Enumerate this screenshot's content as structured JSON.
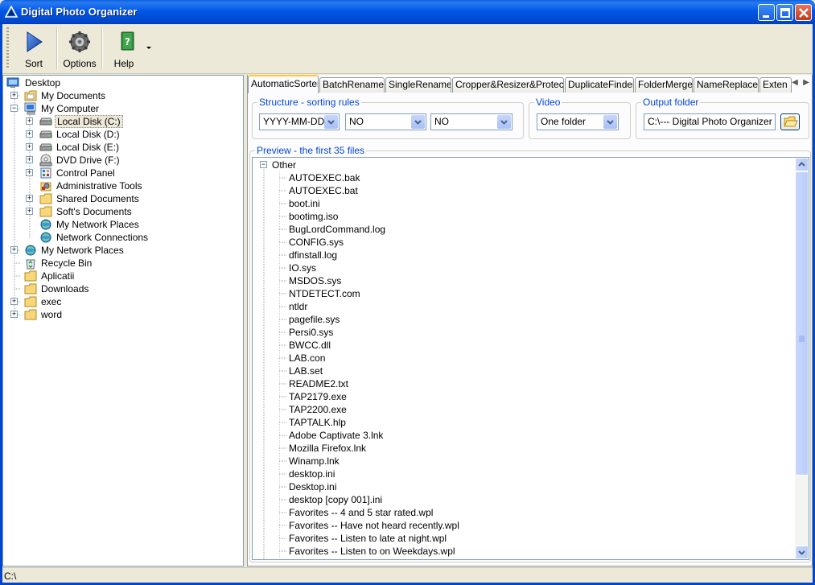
{
  "window": {
    "title": "Digital Photo Organizer"
  },
  "toolbar": {
    "buttons": [
      {
        "label": "Sort",
        "icon": "play-icon"
      },
      {
        "label": "Options",
        "icon": "gear-icon"
      },
      {
        "label": "Help",
        "icon": "help-book-icon"
      }
    ]
  },
  "tree": {
    "nodes": [
      {
        "label": "Desktop",
        "icon": "desktop-icon"
      },
      {
        "label": "My Documents",
        "icon": "folder-icon"
      },
      {
        "label": "My Computer",
        "icon": "computer-icon"
      },
      {
        "label": "Local Disk (C:)",
        "icon": "disk-icon",
        "selected": true
      },
      {
        "label": "Local Disk (D:)",
        "icon": "disk-icon"
      },
      {
        "label": "Local Disk (E:)",
        "icon": "disk-icon"
      },
      {
        "label": "DVD Drive (F:)",
        "icon": "dvd-icon"
      },
      {
        "label": "Control Panel",
        "icon": "control-panel-icon"
      },
      {
        "label": "Administrative Tools",
        "icon": "tools-icon"
      },
      {
        "label": "Shared Documents",
        "icon": "folder-icon"
      },
      {
        "label": "Soft's Documents",
        "icon": "folder-icon"
      },
      {
        "label": "My Network Places",
        "icon": "network-icon"
      },
      {
        "label": "Network Connections",
        "icon": "network-icon"
      },
      {
        "label": "My Network Places",
        "icon": "network-icon"
      },
      {
        "label": "Recycle Bin",
        "icon": "recycle-bin-icon"
      },
      {
        "label": "Aplicatii",
        "icon": "folder-icon"
      },
      {
        "label": "Downloads",
        "icon": "folder-icon"
      },
      {
        "label": "exec",
        "icon": "folder-icon"
      },
      {
        "label": "word",
        "icon": "folder-icon"
      }
    ]
  },
  "tabs": [
    {
      "label": "AutomaticSorter",
      "active": true
    },
    {
      "label": "BatchRenamer"
    },
    {
      "label": "SingleRenamer"
    },
    {
      "label": "Cropper&Resizer&Protector"
    },
    {
      "label": "DuplicateFinder"
    },
    {
      "label": "FolderMerger"
    },
    {
      "label": "NameReplacer"
    },
    {
      "label": "Exten"
    }
  ],
  "structure": {
    "title": "Structure - sorting rules",
    "rule1": "YYYY-MM-DD",
    "rule2": "NO",
    "rule3": "NO"
  },
  "video": {
    "title": "Video",
    "value": "One folder"
  },
  "output": {
    "title": "Output folder",
    "value": "C:\\--- Digital Photo Organizer Sor"
  },
  "preview": {
    "title": "Preview - the first 35 files",
    "root": "Other",
    "files": [
      "AUTOEXEC.bak",
      "AUTOEXEC.bat",
      "boot.ini",
      "bootimg.iso",
      "BugLordCommand.log",
      "CONFIG.sys",
      "dfinstall.log",
      "IO.sys",
      "MSDOS.sys",
      "NTDETECT.com",
      "ntldr",
      "pagefile.sys",
      "Persi0.sys",
      "BWCC.dll",
      "LAB.con",
      "LAB.set",
      "README2.txt",
      "TAP2179.exe",
      "TAP2200.exe",
      "TAPTALK.hlp",
      "Adobe Captivate 3.lnk",
      "Mozilla Firefox.lnk",
      "Winamp.lnk",
      "desktop.ini",
      "Desktop.ini",
      "desktop [copy 001].ini",
      "Favorites -- 4 and 5 star rated.wpl",
      "Favorites -- Have not heard recently.wpl",
      "Favorites -- Listen to late at night.wpl",
      "Favorites -- Listen to on Weekdays.wpl"
    ]
  },
  "status": {
    "path": "C:\\"
  }
}
